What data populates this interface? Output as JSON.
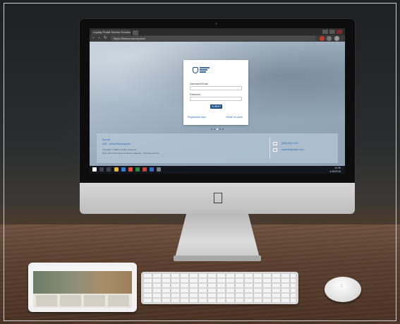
{
  "browser": {
    "tab_title": "Loyalty Portal Service Solutions",
    "url": "https://lifeinsuranceportal"
  },
  "login": {
    "email_label": "Username/Email",
    "password_label": "Password",
    "button_label": "SUBMIT",
    "register_link": "Registrarse Aqui",
    "forgot_link": "Olvidé mi clave"
  },
  "footer": {
    "title": "Ayuda",
    "subtitle": "ASK - Email/Subscripción",
    "note_1": "Copyright © 2018 All rights reserved",
    "note_2": "Para más información contacte a Soporte · Términos de Uso",
    "phone": "(809) 555-1212",
    "email": "soporte@portal.com"
  },
  "taskbar": {
    "time": "10:35",
    "date": "4/18/2018"
  },
  "colors": {
    "accent": "#1f4f8a",
    "link": "#2c6fb5"
  }
}
